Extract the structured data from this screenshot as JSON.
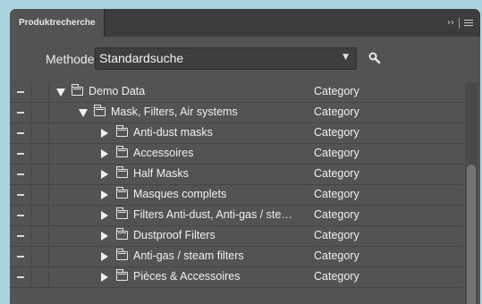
{
  "panel": {
    "tab_title": "Produktrecherche",
    "collapse_glyph": "››",
    "menu_icon": "hamburger-menu-icon"
  },
  "method": {
    "label": "Methode",
    "selected": "Standardsuche",
    "search_icon": "search-icon"
  },
  "tree": {
    "rows": [
      {
        "name": "Demo Data",
        "type": "Category",
        "expanded": true
      },
      {
        "name": "Mask, Filters, Air systems",
        "type": "Category",
        "expanded": true
      },
      {
        "name": "Anti-dust masks",
        "type": "Category",
        "expanded": false
      },
      {
        "name": "Accessoires",
        "type": "Category",
        "expanded": false
      },
      {
        "name": "Half Masks",
        "type": "Category",
        "expanded": false
      },
      {
        "name": "Masques complets",
        "type": "Category",
        "expanded": false
      },
      {
        "name": "Filters Anti-dust, Anti-gas / ste…",
        "type": "Category",
        "expanded": false
      },
      {
        "name": "Dustproof Filters",
        "type": "Category",
        "expanded": false
      },
      {
        "name": "Anti-gas / steam filters",
        "type": "Category",
        "expanded": false
      },
      {
        "name": "Pièces & Accessoires",
        "type": "Category",
        "expanded": false
      }
    ]
  },
  "colors": {
    "background": "#a8d3df",
    "panel": "#535353",
    "tabbar": "#3c3c3c"
  }
}
